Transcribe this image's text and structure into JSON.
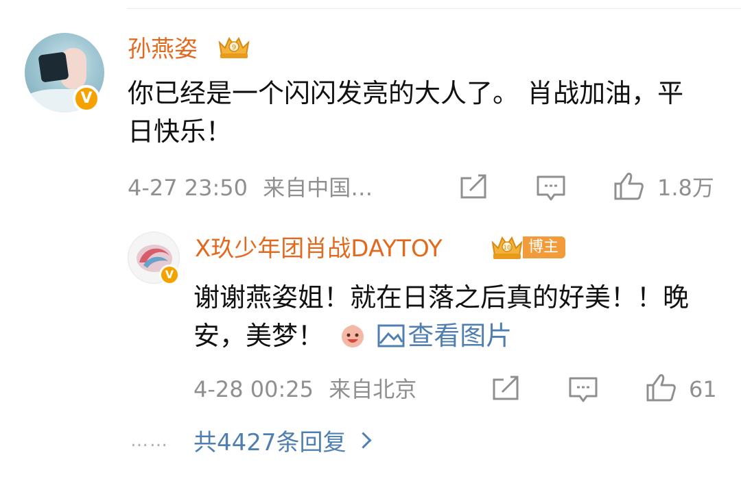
{
  "comment": {
    "username": "孙燕姿",
    "text": "你已经是一个闪闪发亮的大人了。 肖战加油，平日快乐！",
    "timestamp": "4-27 23:50",
    "source": "来自中国…",
    "like_count": "1.8万",
    "verified_badge": "V",
    "icons": {
      "share": "share-icon",
      "comment": "comment-icon",
      "like": "like-icon",
      "crown": "crown-badge-icon"
    }
  },
  "reply": {
    "username": "X玖少年团肖战DAYTOY",
    "badge_label": "博主",
    "text": "谢谢燕姿姐！就在日落之后真的好美！！晚安，美梦！",
    "view_picture_label": "查看图片",
    "timestamp": "4-28 00:25",
    "source": "来自北京",
    "like_count": "61",
    "verified_badge": "V"
  },
  "footer": {
    "more_replies_label": "共4427条回复",
    "dots": "……"
  },
  "colors": {
    "username": "#e26a1f",
    "link": "#4f7fb0",
    "meta": "#8f8f8f",
    "verified": "#f5a100",
    "bozhu_badge": "#f29b3a"
  }
}
